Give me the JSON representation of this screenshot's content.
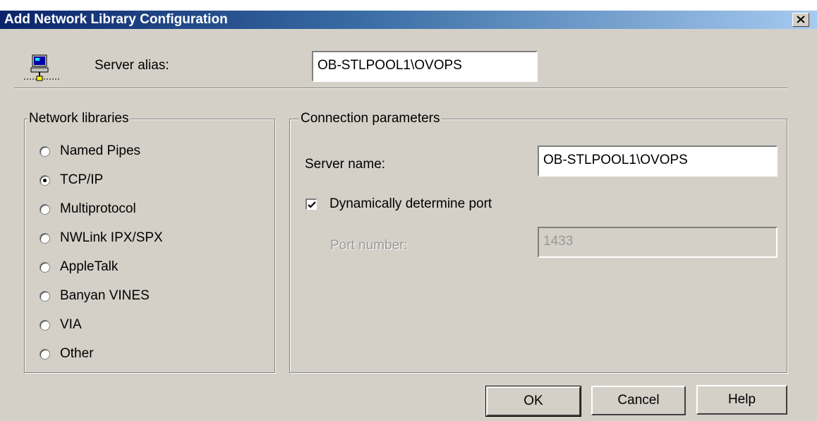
{
  "window": {
    "title": "Add Network Library Configuration"
  },
  "server_alias": {
    "label": "Server alias:",
    "value": "OB-STLPOOL1\\OVOPS"
  },
  "network_libraries": {
    "title": "Network libraries",
    "selected": "TCP/IP",
    "options": [
      {
        "label": "Named Pipes",
        "checked": false
      },
      {
        "label": "TCP/IP",
        "checked": true
      },
      {
        "label": "Multiprotocol",
        "checked": false
      },
      {
        "label": "NWLink IPX/SPX",
        "checked": false
      },
      {
        "label": "AppleTalk",
        "checked": false
      },
      {
        "label": "Banyan VINES",
        "checked": false
      },
      {
        "label": "VIA",
        "checked": false
      },
      {
        "label": "Other",
        "checked": false
      }
    ]
  },
  "connection_parameters": {
    "title": "Connection parameters",
    "server_name_label": "Server name:",
    "server_name_value": "OB-STLPOOL1\\OVOPS",
    "dynamic_port_label": "Dynamically determine port",
    "dynamic_port_checked": true,
    "port_number_label": "Port number:",
    "port_number_value": "1433"
  },
  "buttons": {
    "ok": "OK",
    "cancel": "Cancel",
    "help": "Help"
  },
  "icons": [
    "close-icon",
    "computer-network-icon",
    "checkmark-icon"
  ]
}
